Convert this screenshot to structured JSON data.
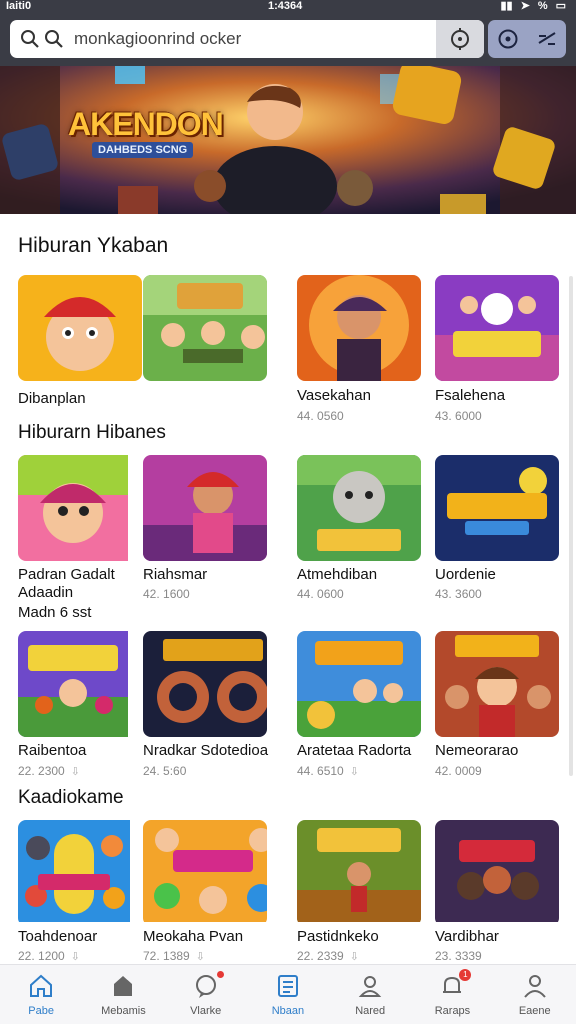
{
  "status_bar": {
    "time_left": "Iaiti0",
    "time_center": "1:4364",
    "icons": [
      "signal-icon",
      "location-icon",
      "battery-icon"
    ],
    "battery_text": "%"
  },
  "search": {
    "value": "monkagioonrind ocker",
    "icon": "search-icon"
  },
  "header_actions": {
    "icons": [
      "compass-icon",
      "filter-icon"
    ]
  },
  "hero": {
    "title": "AKENDON",
    "subtitle": "DAHBEDS SCNG"
  },
  "sections": [
    {
      "title": "Hiburan Ykaban",
      "items": [
        {
          "title": "Dibanplan",
          "sub": "",
          "theme": "#f6b21b"
        },
        {
          "title": "",
          "sub": "",
          "theme": "#6bb04a"
        },
        {
          "title": "Vasekahan",
          "sub": "44. 0560",
          "theme": "#e2631b"
        },
        {
          "title": "Fsalehena",
          "sub": "43. 6000",
          "theme": "#8a3cc2"
        }
      ]
    },
    {
      "title": "Hiburarn Hibanes",
      "items": [
        {
          "title": "Padran Gadalt",
          "title2": "Adaadin",
          "title3": "Madn 6 sst",
          "sub": "",
          "theme": "#f26fa0"
        },
        {
          "title": "Riahsmar",
          "sub": "42. 1600",
          "theme": "#b43ea0"
        },
        {
          "title": "Atmehdiban",
          "sub": "44. 0600",
          "theme": "#4fa24a"
        },
        {
          "title": "Uordenie",
          "sub": "43. 3600",
          "theme": "#1b2d6a"
        }
      ]
    },
    {
      "title": "",
      "items": [
        {
          "title": "Raibentoa",
          "sub": "22. 2300",
          "theme": "#6e49c9"
        },
        {
          "title": "Nradkar Sdotedioa",
          "sub": "24. 5:60",
          "theme": "#1b1f3a"
        },
        {
          "title": "Aratetaa Radorta",
          "sub": "44. 6510",
          "theme": "#3f8ddb"
        },
        {
          "title": "Nemeorarao",
          "sub": "42. 0009",
          "theme": "#b3492b"
        }
      ]
    },
    {
      "title": "Kaadiokame",
      "items": [
        {
          "title": "Toahdenoar",
          "sub": "22. 1200",
          "theme": "#2c8fe0"
        },
        {
          "title": "Meokaha Pvan",
          "sub": "72. 1389",
          "theme": "#f3a42a"
        },
        {
          "title": "Pastidnkeko",
          "sub": "22. 2339",
          "theme": "#6b8f2a"
        },
        {
          "title": "Vardibhar",
          "sub": "23. 3339",
          "theme": "#3d2a52"
        }
      ]
    }
  ],
  "bottom_nav": [
    {
      "label": "Pabe",
      "icon": "home-icon",
      "active": true
    },
    {
      "label": "Mebamis",
      "icon": "house-icon",
      "active": false
    },
    {
      "label": "Vlarke",
      "icon": "chat-icon",
      "active": false,
      "badge": true
    },
    {
      "label": "Nbaan",
      "icon": "list-icon",
      "active": true
    },
    {
      "label": "Nared",
      "icon": "person-icon",
      "active": false
    },
    {
      "label": "Raraps",
      "icon": "bell-icon",
      "active": false,
      "badge_num": "1"
    },
    {
      "label": "Eaene",
      "icon": "profile-icon",
      "active": false
    }
  ]
}
